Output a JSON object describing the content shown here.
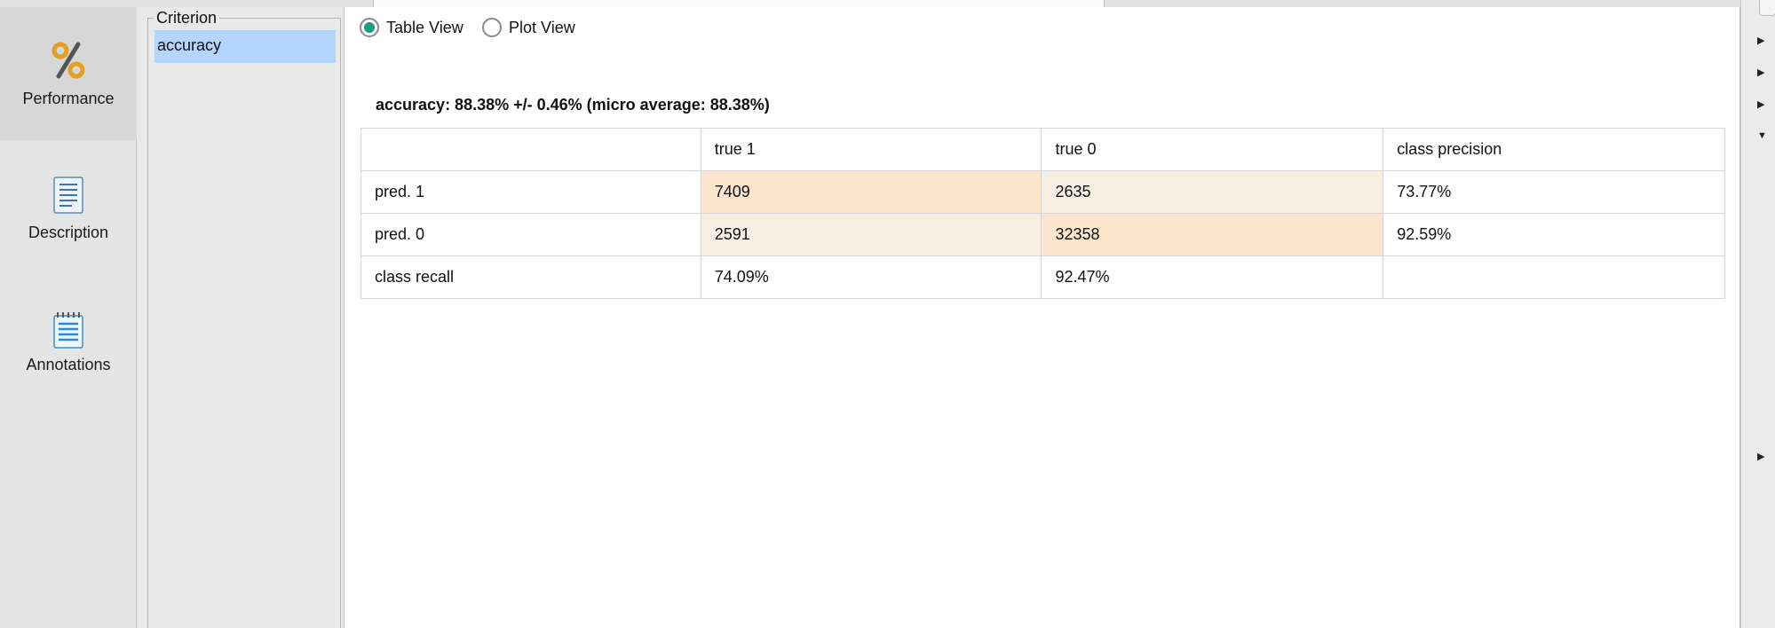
{
  "nav": {
    "items": [
      {
        "label": "Performance",
        "icon": "percent-icon"
      },
      {
        "label": "Description",
        "icon": "document-icon"
      },
      {
        "label": "Annotations",
        "icon": "notepad-icon"
      }
    ]
  },
  "criterion": {
    "legend": "Criterion",
    "selected": "accuracy"
  },
  "view": {
    "table_label": "Table View",
    "plot_label": "Plot View",
    "selected": "Table View"
  },
  "result": {
    "summary": "accuracy: 88.38% +/- 0.46% (micro average: 88.38%)",
    "header": [
      "",
      "true 1",
      "true 0",
      "class precision"
    ],
    "rows": [
      [
        "pred. 1",
        "7409",
        "2635",
        "73.77%"
      ],
      [
        "pred. 0",
        "2591",
        "32358",
        "92.59%"
      ],
      [
        "class recall",
        "74.09%",
        "92.47%",
        ""
      ]
    ]
  },
  "colors": {
    "accent": "#1d9a82",
    "selection": "#b3d6ff",
    "correct_cell": "#fbe6cd",
    "error_cell": "#f8efe3"
  }
}
